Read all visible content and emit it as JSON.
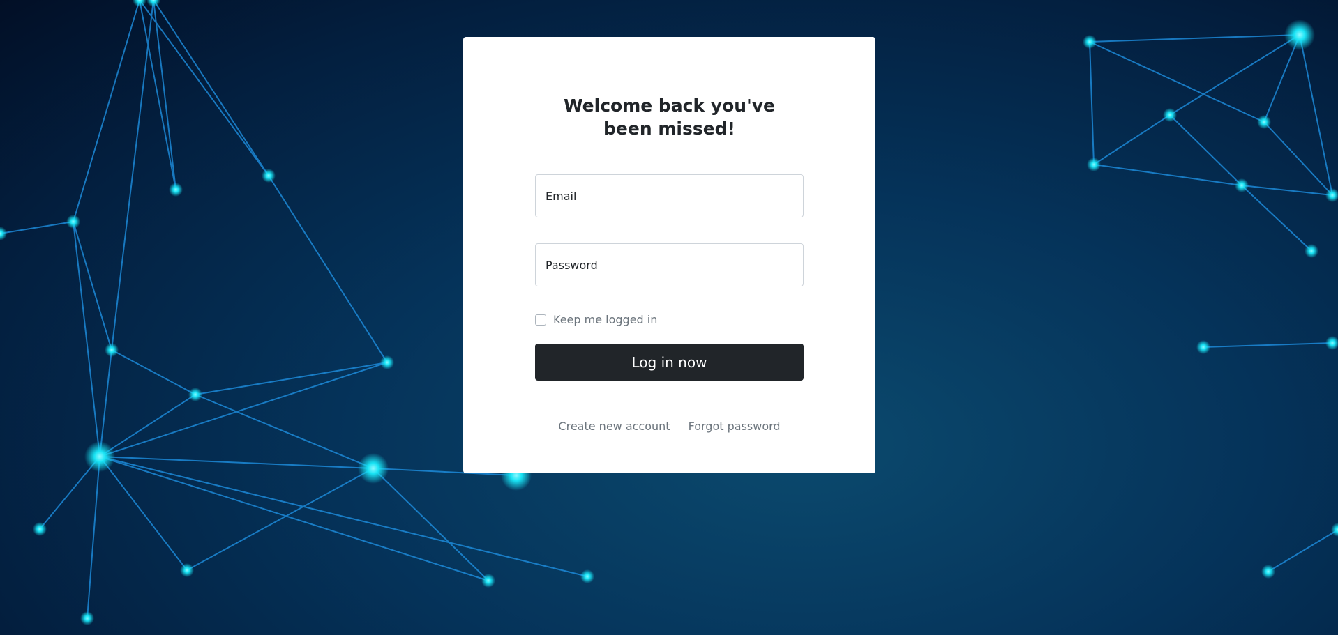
{
  "login": {
    "title": "Welcome back you've been missed!",
    "email_placeholder": "Email",
    "password_placeholder": "Password",
    "remember_label": "Keep me logged in",
    "submit_label": "Log in now",
    "create_account_link": "Create new account",
    "forgot_password_link": "Forgot password"
  },
  "colors": {
    "button": "#212529",
    "accent_glow": "#19e4f5"
  }
}
